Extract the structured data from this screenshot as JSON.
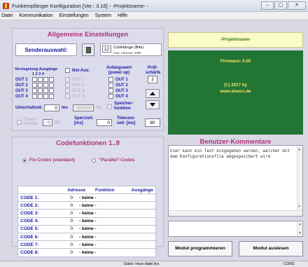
{
  "window": {
    "title": "Funkempfänger Konfiguration  [Ver.: 3.16]   - -Projektname- -",
    "min": "–",
    "max": "▢",
    "close": "✕"
  },
  "menu": [
    "Datei",
    "Kommunikation",
    "Einstellungen",
    "System",
    "Hilfe"
  ],
  "settings": {
    "title": "Allgemeine Einstellungen",
    "sender_label": "Senderauswahl:",
    "code_value": "12",
    "code_label": "Codelänge (Bits)",
    "max_address": "max. Adresse: 4095",
    "lock_label": "Verriegelung Ausgänge",
    "lock_cols": "1  2  3  4",
    "outputs": [
      "OUT 1",
      "OUT 2",
      "OUT 3",
      "OUT 4"
    ],
    "not_aus_label": "Not-Aus:",
    "anfangswert_label": "Anfangswert (power up)",
    "pruef_label": "Prüf-schärfe",
    "pruef_value": "2",
    "umschaltzeit_label": "Umschaltzeit:",
    "umschaltzeit_value": "0",
    "umschaltzeit_unit": "ms",
    "disabled_value": "000000",
    "disabled_unit": "ms",
    "speicher_label": "Speicher-funktion",
    "check_label": "Check-summe",
    "check_value": "0",
    "check_unit": "Bit",
    "sperrzeit_label": "Sperrzeit: [ms]",
    "sperrzeit_value": "0",
    "toleranz_label": "Toleranz-zeit: [ms]",
    "toleranz_value": "80"
  },
  "info": {
    "projektname": "-Projektname-",
    "firmware": "Firmware:   0.00",
    "copyright": "(C) 2017 by",
    "website": "www.elseco.de"
  },
  "codes": {
    "title": "Codefunktionen 1..8",
    "radio_fix": "Fix-Codes (standard)",
    "radio_parallel": "\"Parallel\"-Codes",
    "headers": {
      "adresse": "Adresse",
      "funktion": "Funktion",
      "ausgaenge": "Ausgänge"
    },
    "rows": [
      {
        "name": "CODE 1:",
        "adresse": "0",
        "funktion": "- keine -"
      },
      {
        "name": "CODE 2:",
        "adresse": "0",
        "funktion": "- keine -"
      },
      {
        "name": "CODE 3:",
        "adresse": "0",
        "funktion": "- keine -"
      },
      {
        "name": "CODE 4:",
        "adresse": "0",
        "funktion": "- keine -"
      },
      {
        "name": "CODE 5:",
        "adresse": "0",
        "funktion": "- keine -"
      },
      {
        "name": "CODE 6:",
        "adresse": "0",
        "funktion": "- keine -"
      },
      {
        "name": "CODE 7:",
        "adresse": "0",
        "funktion": "- keine -"
      },
      {
        "name": "CODE 8:",
        "adresse": "0",
        "funktion": "- keine -"
      }
    ]
  },
  "comments": {
    "title": "Benutzer-Kommentare",
    "text": "hier kann ein Text eingegeben werden, welcher mit dem Konfigurationsfile abgespeichert wird"
  },
  "buttons": {
    "program": "Modul programmieren",
    "read": "Modul auslesen"
  },
  "status": {
    "file": "Datei:  neue datei.fox",
    "port": "COM1"
  }
}
